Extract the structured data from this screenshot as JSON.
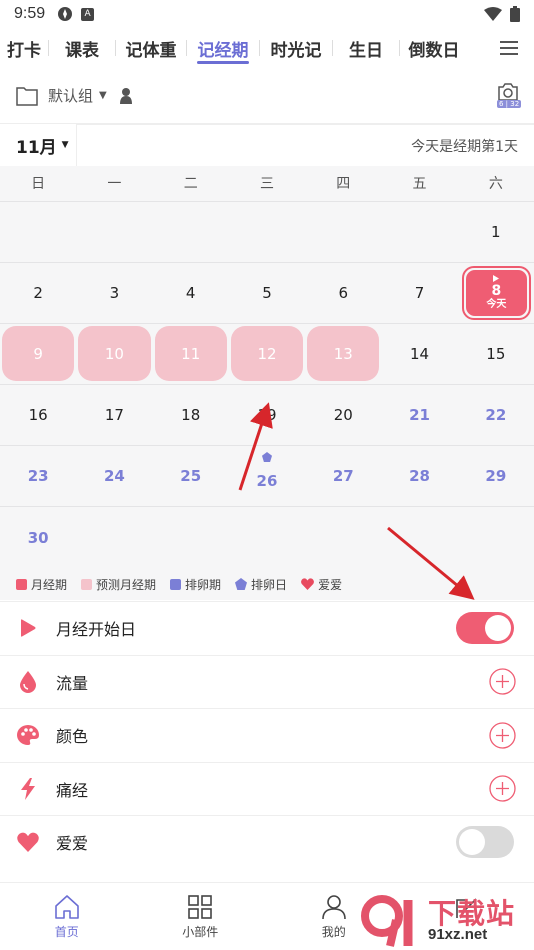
{
  "status_bar": {
    "time": "9:59"
  },
  "tabs": [
    {
      "label": "打卡"
    },
    {
      "label": "课表"
    },
    {
      "label": "记体重"
    },
    {
      "label": "记经期",
      "active": true
    },
    {
      "label": "时光记"
    },
    {
      "label": "生日"
    },
    {
      "label": "倒数日"
    }
  ],
  "group": {
    "name": "默认组",
    "camera_badge": "6 | 32"
  },
  "month": {
    "label": "11月",
    "today_text": "今天是经期第1天"
  },
  "weekdays": [
    "日",
    "一",
    "二",
    "三",
    "四",
    "五",
    "六"
  ],
  "calendar": {
    "rows": [
      [
        "",
        "",
        "",
        "",
        "",
        "",
        "1"
      ],
      [
        "2",
        "3",
        "4",
        "5",
        "6",
        "7",
        "8"
      ],
      [
        "9",
        "10",
        "11",
        "12",
        "13",
        "14",
        "15"
      ],
      [
        "16",
        "17",
        "18",
        "19",
        "20",
        "21",
        "22"
      ],
      [
        "23",
        "24",
        "25",
        "26",
        "27",
        "28",
        "29"
      ],
      [
        "30",
        "",
        "",
        "",
        "",
        "",
        ""
      ]
    ],
    "today_label": "今天",
    "predicted_days": [
      "9",
      "10",
      "11",
      "12",
      "13"
    ],
    "ovulation_days": [
      "21",
      "22",
      "23",
      "24",
      "25",
      "26",
      "27",
      "28",
      "29",
      "30"
    ],
    "ovulation_day": "26",
    "today": "8"
  },
  "legend": [
    {
      "label": "月经期",
      "color": "#ef5d73",
      "shape": "square"
    },
    {
      "label": "预测月经期",
      "color": "#f4c3cb",
      "shape": "square"
    },
    {
      "label": "排卵期",
      "color": "#7b7fd6",
      "shape": "square"
    },
    {
      "label": "排卵日",
      "color": "#7b7fd6",
      "shape": "pentagon"
    },
    {
      "label": "爱爱",
      "color": "#e84a5f",
      "shape": "heart"
    }
  ],
  "settings": [
    {
      "label": "月经开始日",
      "icon": "flag-icon",
      "control": "toggle",
      "on": true
    },
    {
      "label": "流量",
      "icon": "drop-icon",
      "control": "add"
    },
    {
      "label": "颜色",
      "icon": "palette-icon",
      "control": "add"
    },
    {
      "label": "痛经",
      "icon": "lightning-icon",
      "control": "add"
    },
    {
      "label": "爱爱",
      "icon": "heart-icon",
      "control": "toggle",
      "on": false
    }
  ],
  "nav": [
    {
      "label": "首页",
      "icon": "home-icon",
      "active": true
    },
    {
      "label": "小部件",
      "icon": "widgets-icon"
    },
    {
      "label": "我的",
      "icon": "profile-icon"
    }
  ],
  "watermark": {
    "text": "下载站",
    "url": "91xz.net"
  },
  "colors": {
    "accent": "#6b6ed4",
    "period": "#ef5d73",
    "predicted": "#f4c3cb",
    "ovulation": "#7b7fd6"
  }
}
